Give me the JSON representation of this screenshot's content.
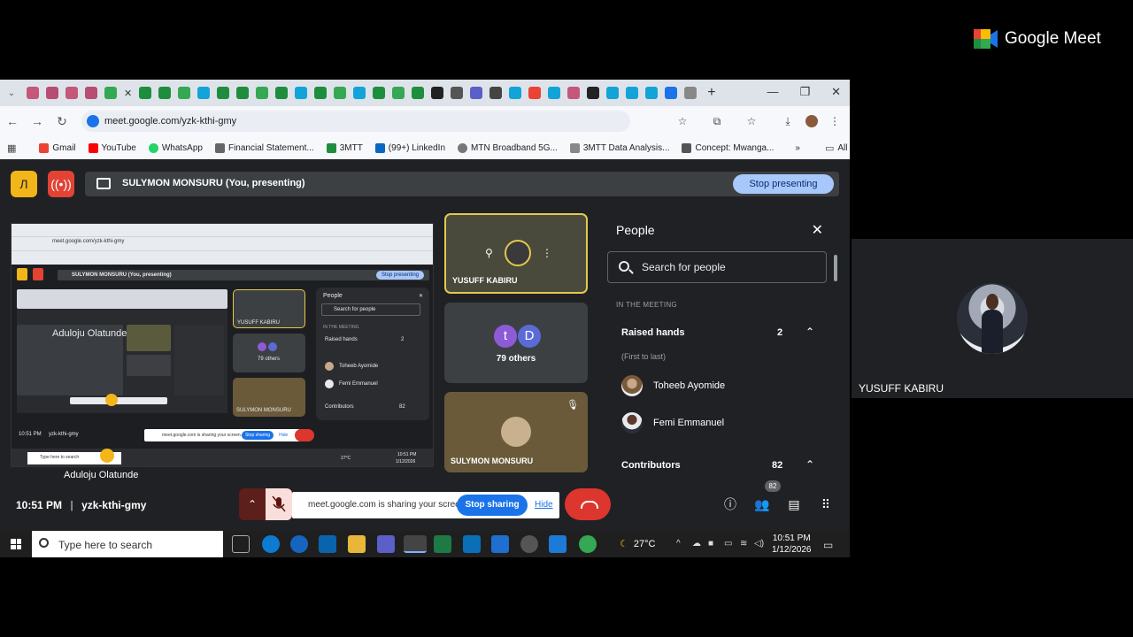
{
  "brand": {
    "name": "Google Meet"
  },
  "outer_tile": {
    "name": "YUSUFF KABIRU"
  },
  "browser": {
    "url": "meet.google.com/yzk-kthi-gmy",
    "bookmarks": [
      "Gmail",
      "YouTube",
      "WhatsApp",
      "Financial Statement...",
      "3MTT",
      "(99+) LinkedIn",
      "MTN Broadband 5G...",
      "3MTT Data Analysis...",
      "Concept: Mwanga..."
    ],
    "all_bookmarks": "All Bookmarks",
    "more": "»"
  },
  "presenting": {
    "label": "SULYMON MONSURU (You, presenting)",
    "stop_label": "Stop presenting"
  },
  "preview": {
    "name": "Aduloju Olatunde",
    "overlay_name": "Aduloju Olatunde",
    "url": "meet.google.com/yzk-kthi-gmy",
    "presenting": "SULYMON MONSURU (You, presenting)",
    "stop": "Stop presenting",
    "people": "People",
    "search": "Search for people",
    "in_meeting": "IN THE MEETING",
    "raised": "Raised hands",
    "raised_count": "2",
    "p1": "Toheeb Ayomide",
    "p2": "Femi Emmanuel",
    "contributors": "Contributors",
    "contributors_count": "82",
    "tile1": "YUSUFF KABIRU",
    "tile2": "79 others",
    "tile3": "SULYMON MONSURU",
    "time": "10:51 PM",
    "code": "yzk-kthi-gmy",
    "sharing": "meet.google.com is sharing your screen.",
    "stop_sharing": "Stop sharing",
    "hide": "Hide",
    "search_tb": "Type here to search",
    "temp": "27°C",
    "clock": "10:51 PM",
    "date": "1/12/2026"
  },
  "tiles": [
    {
      "name": "YUSUFF KABIRU"
    },
    {
      "initials": [
        "t",
        "D"
      ],
      "label": "79 others"
    },
    {
      "name": "SULYMON MONSURU"
    }
  ],
  "people_panel": {
    "title": "People",
    "search_placeholder": "Search for people",
    "section": "IN THE MEETING",
    "raised_hands": {
      "label": "Raised hands",
      "count": "2",
      "sub": "(First to last)"
    },
    "people": [
      "Toheeb Ayomide",
      "Femi Emmanuel"
    ],
    "contributors": {
      "label": "Contributors",
      "count": "82"
    }
  },
  "meet_bar": {
    "time": "10:51 PM",
    "separator": "|",
    "code": "yzk-kthi-gmy",
    "sharing_message": "meet.google.com is sharing your screen.",
    "stop_sharing": "Stop sharing",
    "hide": "Hide",
    "people_badge": "82"
  },
  "taskbar": {
    "search_placeholder": "Type here to search",
    "weather": "27°C",
    "time": "10:51 PM",
    "date": "1/12/2026"
  },
  "colors": {
    "accent": "#a8c7fa",
    "end_call": "#dc362e",
    "meet_bg": "#202124",
    "tile": "#3c4043",
    "active_speaker": "#e3c84d"
  }
}
